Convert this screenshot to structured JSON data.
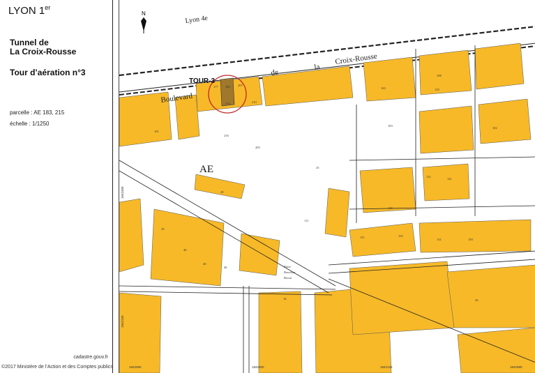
{
  "header": {
    "city": "LYON 1",
    "city_sup": "er",
    "project_line1": "Tunnel de",
    "project_line2": "La Croix-Rousse",
    "subject": "Tour d’aération n°3"
  },
  "meta": {
    "parcel": "parcelle : AE 183, 215",
    "scale": "échelle : 1/1250"
  },
  "footer": {
    "source": "cadastre.gouv.fr",
    "copyright": "©2017 Ministère de l’Action et des Comptes publics"
  },
  "map": {
    "colors": {
      "building": "#f7b928",
      "building_dark": "#a0782c",
      "road_line": "#222222",
      "parcel_line": "#555555",
      "marker": "#c0282a"
    },
    "compass": "N",
    "district_label": "Lyon 4e",
    "tour_label": "TOUR-3",
    "section_label": "AE",
    "streets": {
      "boulevard_word1": "Boulevard",
      "boulevard_word2": "de",
      "boulevard_word3": "la",
      "boulevard_word4": "Croix-Rousse"
    },
    "square_label_1": "Place",
    "square_label_2": "Bouchon",
    "square_label_3": "Biscui",
    "parcel_numbers": [
      "177",
      "183",
      "207",
      "210",
      "215",
      "216",
      "101",
      "205",
      "28",
      "25",
      "121",
      "108",
      "163",
      "102",
      "103",
      "129",
      "151",
      "152",
      "119",
      "112",
      "131",
      "150",
      "111",
      "36",
      "39",
      "16",
      "40",
      "46",
      "40"
    ],
    "coords": [
      "1842400",
      "1842150",
      "1842300",
      "1842125",
      "1842080",
      "1842050"
    ]
  }
}
